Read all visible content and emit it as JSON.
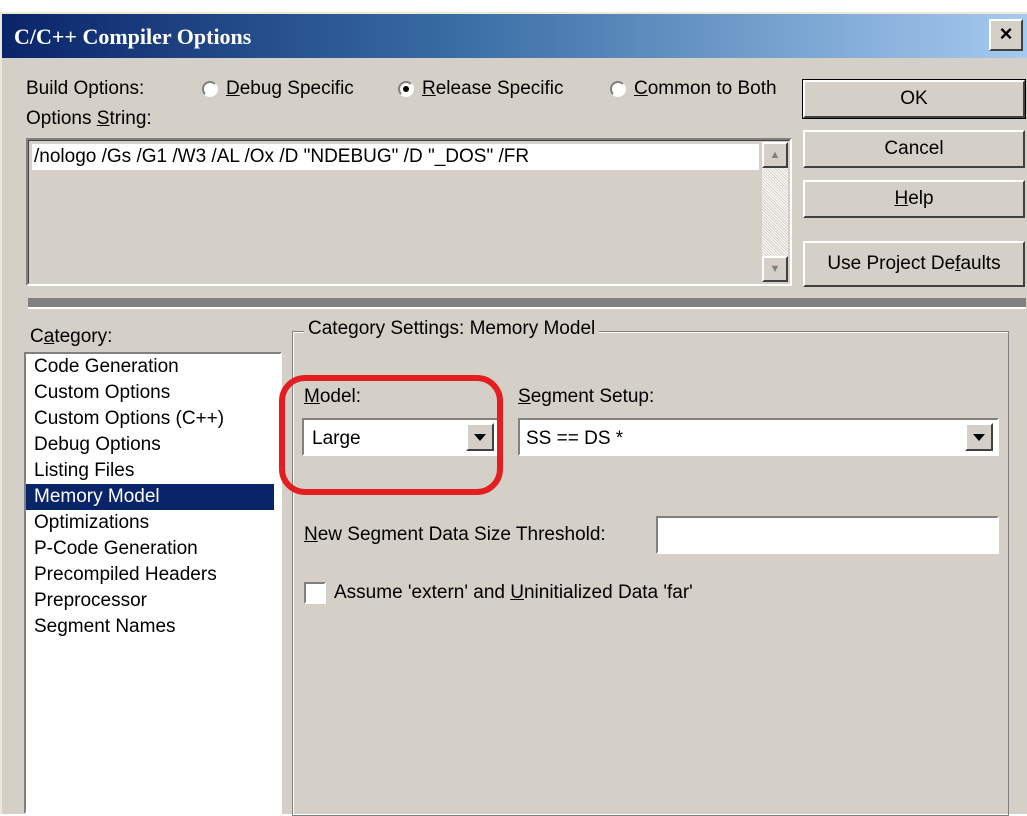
{
  "window": {
    "title": "C/C++ Compiler Options",
    "close_glyph": "×"
  },
  "build_options": {
    "label": "Build Options:",
    "radios": [
      {
        "pre": "",
        "accel": "D",
        "post": "ebug Specific",
        "selected": false
      },
      {
        "pre": "",
        "accel": "R",
        "post": "elease Specific",
        "selected": true
      },
      {
        "pre": "",
        "accel": "C",
        "post": "ommon to Both",
        "selected": false
      }
    ]
  },
  "options_string": {
    "label_pre": "Options ",
    "label_accel": "S",
    "label_post": "tring:",
    "value": "/nologo /Gs /G1 /W3 /AL /Ox /D \"NDEBUG\" /D \"_DOS\" /FR"
  },
  "buttons": {
    "ok": "OK",
    "cancel": "Cancel",
    "help_accel": "H",
    "help_post": "elp",
    "defaults_pre": "Use Project De",
    "defaults_accel": "f",
    "defaults_post": "aults"
  },
  "category": {
    "label_pre": "C",
    "label_accel": "a",
    "label_post": "tegory:",
    "items": [
      "Code Generation",
      "Custom Options",
      "Custom Options (C++)",
      "Debug Options",
      "Listing Files",
      "Memory Model",
      "Optimizations",
      "P-Code Generation",
      "Precompiled Headers",
      "Preprocessor",
      "Segment Names"
    ],
    "selected_index": 5
  },
  "settings": {
    "group_title": "Category Settings: Memory Model",
    "model_label_accel": "M",
    "model_label_post": "odel:",
    "model_value": "Large",
    "segment_label_accel": "S",
    "segment_label_post": "egment Setup:",
    "segment_value": "SS == DS *",
    "threshold_label_accel": "N",
    "threshold_label_post": "ew Segment Data Size Threshold:",
    "threshold_value": "",
    "checkbox_pre": "Assume 'extern' and ",
    "checkbox_accel": "U",
    "checkbox_post": "ninitialized Data 'far'",
    "checkbox_checked": false
  },
  "colors": {
    "title_gradient_start": "#0a246a",
    "dialog_face": "#d4d0c8",
    "selection": "#0a246a",
    "highlight_ring": "#e41e20"
  },
  "icons": [
    "close-icon",
    "scroll-up-icon",
    "scroll-down-icon",
    "dropdown-arrow-icon"
  ]
}
